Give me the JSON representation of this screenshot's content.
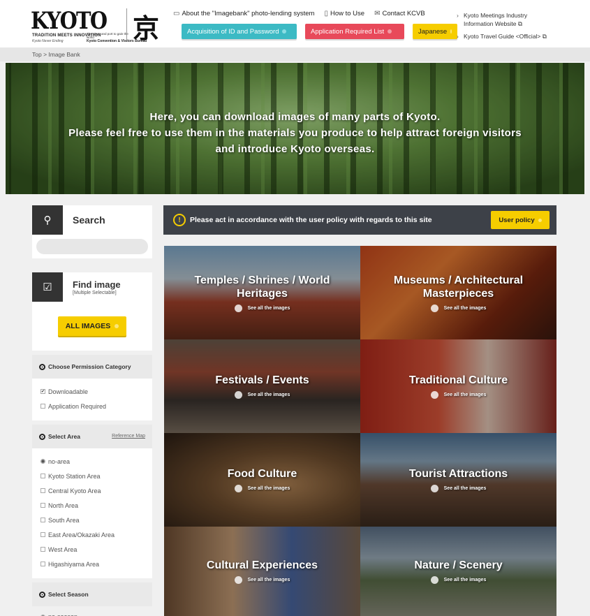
{
  "header": {
    "logo_text": "KYOTO",
    "logo_tagline": "TRADITION MEETS INNOVATION",
    "logo_sub": "Kyoto Never Ending",
    "logo_assoc": "The place and port to gain the world",
    "logo_bureau": "Kyoto Convention & Visitors Bureau",
    "logo_kanji": "京",
    "nav": [
      {
        "label": "About the \"Imagebank\" photo-lending system",
        "icon": "monitor-icon"
      },
      {
        "label": "How to Use",
        "icon": "book-icon"
      },
      {
        "label": "Contact KCVB",
        "icon": "mail-icon"
      }
    ],
    "buttons": {
      "acquisition": "Acquisition of ID and Password",
      "application": "Application Required List",
      "language": "Japanese"
    },
    "side_links": [
      "Kyoto Meetings Industry Information Website",
      "Kyoto Travel Guide <Official>"
    ]
  },
  "breadcrumb": "Top > Image Bank",
  "hero": {
    "line1": "Here, you can download images of many parts of Kyoto.",
    "line2": "Please feel free to use them in the materials you produce to help attract foreign visitors",
    "line3": "and introduce Kyoto overseas."
  },
  "sidebar": {
    "search_label": "Search",
    "search_placeholder": "",
    "find_title": "Find image",
    "find_sub": "[Multiple Selectable]",
    "all_images": "ALL IMAGES",
    "permission": {
      "title": "Choose Permission Category",
      "options": [
        "Downloadable",
        "Application Required"
      ]
    },
    "area": {
      "title": "Select Area",
      "ref_map": "Reference Map",
      "options": [
        "no-area",
        "Kyoto Station Area",
        "Central Kyoto Area",
        "North Area",
        "South Area",
        "East Area/Okazaki Area",
        "West Area",
        "Higashiyama Area"
      ]
    },
    "season": {
      "title": "Select Season",
      "first_option": "no-season"
    }
  },
  "notice": {
    "text": "Please act in accordance with the user policy with regards to this site",
    "button": "User policy"
  },
  "categories": [
    {
      "title": "Temples / Shrines / World Heritages",
      "see": "See all the images"
    },
    {
      "title": "Museums / Architectural Masterpieces",
      "see": "See all the images"
    },
    {
      "title": "Festivals / Events",
      "see": "See all the images"
    },
    {
      "title": "Traditional Culture",
      "see": "See all the images"
    },
    {
      "title": "Food Culture",
      "see": "See all the images"
    },
    {
      "title": "Tourist Attractions",
      "see": "See all the images"
    },
    {
      "title": "Cultural Experiences",
      "see": "See all the images"
    },
    {
      "title": "Nature / Scenery",
      "see": "See all the images"
    }
  ],
  "colors": {
    "teal": "#3cbac4",
    "red": "#e8495a",
    "yellow": "#f6cd00",
    "dark": "#3d4148"
  }
}
